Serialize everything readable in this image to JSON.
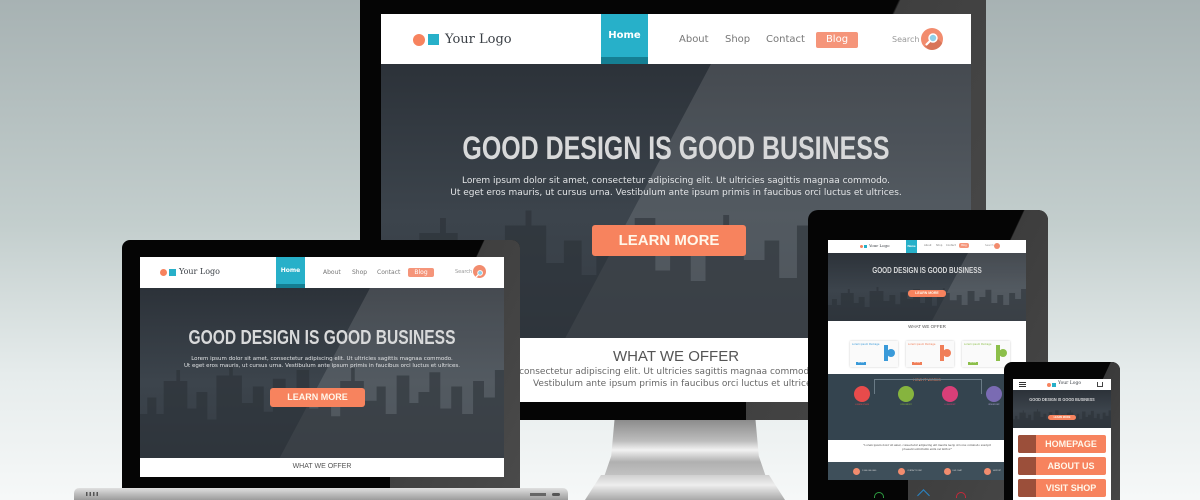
{
  "colors": {
    "accent_teal": "#27b0c9",
    "accent_teal_dark": "#157f93",
    "accent_orange": "#f7835e",
    "blog_orange": "#f5957a",
    "hero_dark": "#323940",
    "bezel": "#050505"
  },
  "site": {
    "logo_text": "Your Logo",
    "nav": {
      "home": "Home",
      "about": "About",
      "shop": "Shop",
      "contact": "Contact",
      "blog": "Blog",
      "search_label": "Search"
    },
    "hero": {
      "title": "GOOD DESIGN IS GOOD BUSINESS",
      "subtitle_line1": "Lorem ipsum dolor sit amet, consectetur adipiscing elit. Ut ultricies sagittis magnaa commodo.",
      "subtitle_line2": "Ut eget eros mauris, ut cursus urna. Vestibulum ante ipsum primis in faucibus orci luctus et ultrices.",
      "cta": "LEARN MORE"
    },
    "offer": {
      "title": "WHAT WE OFFER",
      "text_line1": "amet, consectetur adipiscing elit. Ut ultricies sagittis magnaa commodo. Ut eget e",
      "text_line2": "Vestibulum ante ipsum primis in faucibus orci luctus et ultrices."
    },
    "packages": [
      {
        "title": "Lorem ipsum Package",
        "color": "#3a9ad9",
        "badge": "$29",
        "button": "MORE"
      },
      {
        "title": "Lorem ipsum Package",
        "color": "#f07e58",
        "badge": "$39",
        "button": "MORE"
      },
      {
        "title": "Lorem ipsum Package",
        "color": "#8cbf4a",
        "badge": "$49",
        "button": "MORE"
      }
    ],
    "how_it_works": {
      "title": "HOW IT WORKS",
      "steps": [
        {
          "icon": "laptop-icon",
          "label": "LOREM IPSUM",
          "color": "#e84b4b"
        },
        {
          "icon": "search-icon",
          "label": "UPSUMDNT",
          "color": "#86b43e"
        },
        {
          "icon": "cart-icon",
          "label": "LOREMDNT",
          "color": "#d83f78"
        },
        {
          "icon": "thumbs-up-icon",
          "label": "IPSUM DNT",
          "color": "#7a6bb3"
        }
      ]
    },
    "quote": "\"Lorem ipsum dolor sit amet, consectetur adipiscing elit mauris necip ut locus commodo suscipit proesent sollicitudin enim vel mirbor\"",
    "footer_contacts": [
      {
        "icon": "phone-icon",
        "label": "1 800 000 0000"
      },
      {
        "icon": "mail-icon",
        "label": "CONTACT FORM"
      },
      {
        "icon": "chat-icon",
        "label": "LIVE CHAT"
      },
      {
        "icon": "support-icon",
        "label": "SUPPORT"
      }
    ],
    "mobile_menu": [
      {
        "icon": "home-icon",
        "label": "HOMEPAGE"
      },
      {
        "icon": "users-icon",
        "label": "ABOUT US"
      },
      {
        "icon": "cart-icon",
        "label": "VISIT SHOP"
      }
    ]
  }
}
